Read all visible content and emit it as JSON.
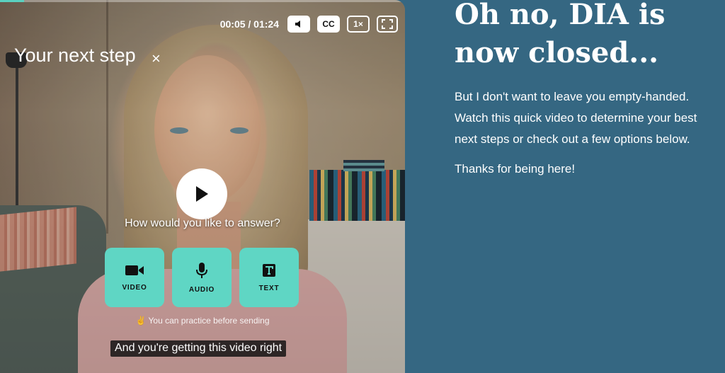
{
  "video": {
    "progress_fraction": 0.06,
    "time_display": "00:05 / 01:24",
    "cc_label": "CC",
    "speed_label": "1×",
    "panel_title": "Your next step",
    "close_label": "×",
    "question": "How would you like to answer?",
    "answer_options": [
      {
        "label": "VIDEO",
        "icon": "video-camera-icon"
      },
      {
        "label": "AUDIO",
        "icon": "microphone-icon"
      },
      {
        "label": "TEXT",
        "icon": "text-icon"
      }
    ],
    "practice_note": "✌ You can practice before sending",
    "caption": "And you're getting this video right",
    "accent_color": "#5fd6c4"
  },
  "page": {
    "headline_line1": "Oh no, DIA is",
    "headline_line2": "now closed...",
    "body_line1": "But I don't want to leave you empty-handed.",
    "body_line2": "Watch this quick video to determine your best",
    "body_line3": "next steps or check out a few options below.",
    "thanks": "Thanks for being here!",
    "background_color": "#356782"
  }
}
